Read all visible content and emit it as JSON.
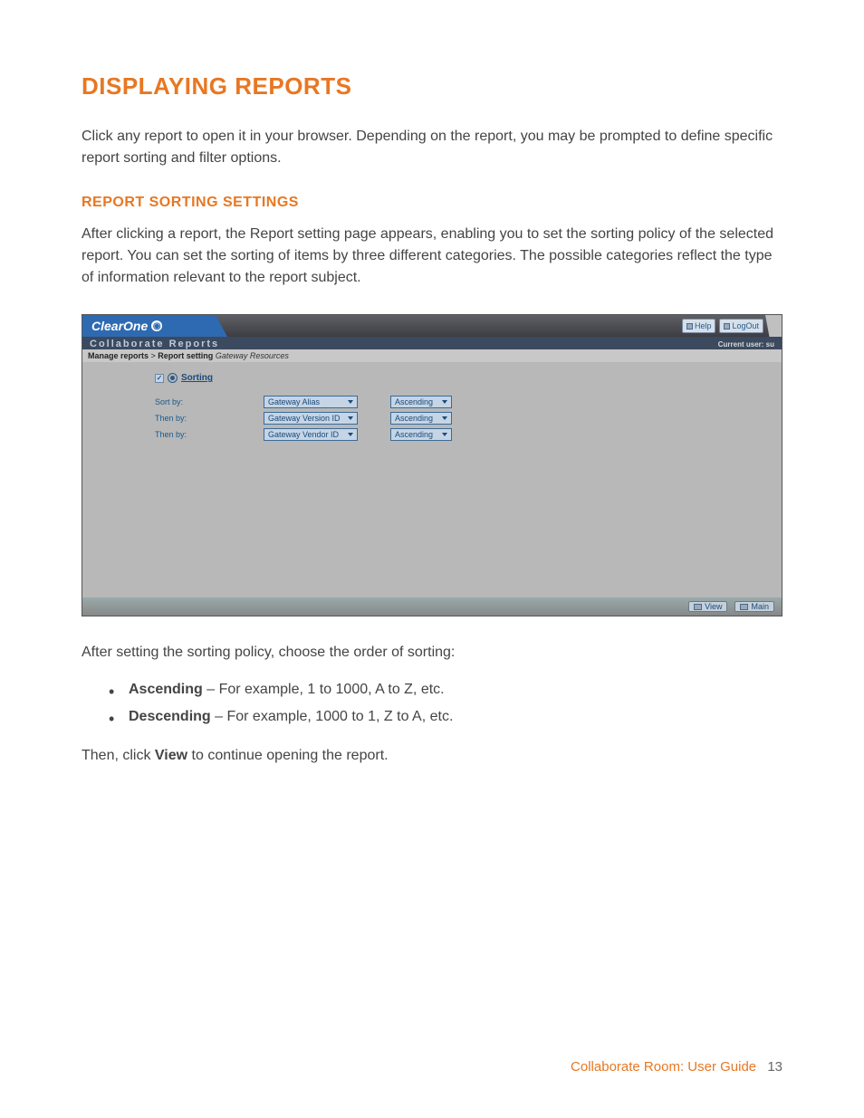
{
  "title": "DISPLAYING REPORTS",
  "intro": "Click any report to open it in your browser. Depending on the report, you may be prompted to define specific report sorting and filter options.",
  "section_title": "REPORT SORTING SETTINGS",
  "section_body": "After clicking a report, the Report setting page appears, enabling you to set the sorting policy of the selected report. You can set the sorting of items by three different categories. The possible categories reflect the type of information relevant to the report subject.",
  "screenshot": {
    "brand": "ClearOne",
    "top_buttons": {
      "help": "Help",
      "logout": "LogOut"
    },
    "subtitle": "Collaborate Reports",
    "current_user_label": "Current user: su",
    "breadcrumb": {
      "a": "Manage reports",
      "b": "Report setting",
      "c": "Gateway Resources"
    },
    "sorting_label": "Sorting",
    "rows": [
      {
        "label": "Sort by:",
        "field": "Gateway Alias",
        "order": "Ascending"
      },
      {
        "label": "Then by:",
        "field": "Gateway Version ID",
        "order": "Ascending"
      },
      {
        "label": "Then by:",
        "field": "Gateway Vendor ID",
        "order": "Ascending"
      }
    ],
    "footer": {
      "view": "View",
      "main": "Main"
    }
  },
  "after_text": "After setting the sorting policy, choose the order of sorting:",
  "bullets": [
    {
      "term": "Ascending",
      "desc": " – For example, 1 to 1000, A to Z, etc."
    },
    {
      "term": "Descending",
      "desc": " – For example, 1000 to 1, Z to A, etc."
    }
  ],
  "final_a": "Then, click ",
  "final_b": "View",
  "final_c": " to continue opening the report.",
  "footer": {
    "doc": "Collaborate Room: User Guide",
    "page": "13"
  }
}
